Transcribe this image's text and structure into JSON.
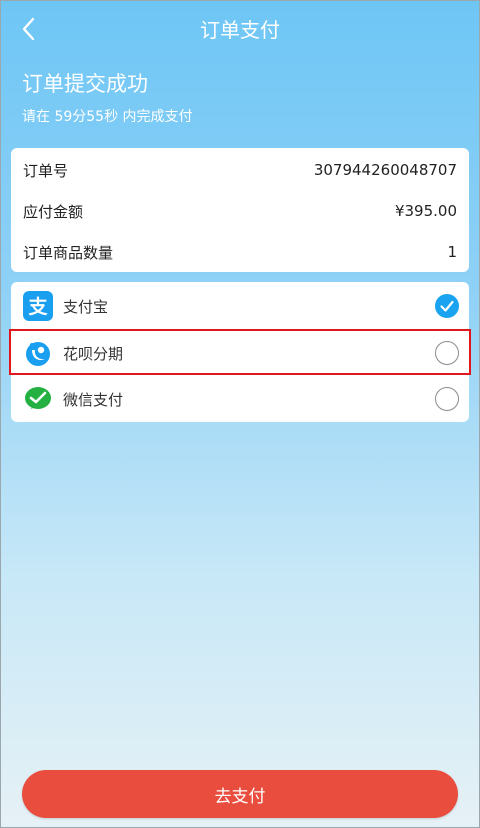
{
  "header": {
    "title": "订单支付"
  },
  "status": {
    "success_text": "订单提交成功",
    "countdown_text": "请在 59分55秒 内完成支付"
  },
  "order": {
    "rows": [
      {
        "label": "订单号",
        "value": "307944260048707"
      },
      {
        "label": "应付金额",
        "value": "¥395.00"
      },
      {
        "label": "订单商品数量",
        "value": "1"
      }
    ]
  },
  "payment_methods": [
    {
      "label": "支付宝",
      "icon": "alipay-icon",
      "selected": true
    },
    {
      "label": "花呗分期",
      "icon": "huabei-icon",
      "selected": false
    },
    {
      "label": "微信支付",
      "icon": "wechat-pay-icon",
      "selected": false
    }
  ],
  "pay_button": {
    "label": "去支付"
  },
  "colors": {
    "primary_blue": "#1aa3f0",
    "pay_button_red": "#e84d3d",
    "highlight_red": "#e0181b",
    "wechat_green": "#24b142"
  }
}
